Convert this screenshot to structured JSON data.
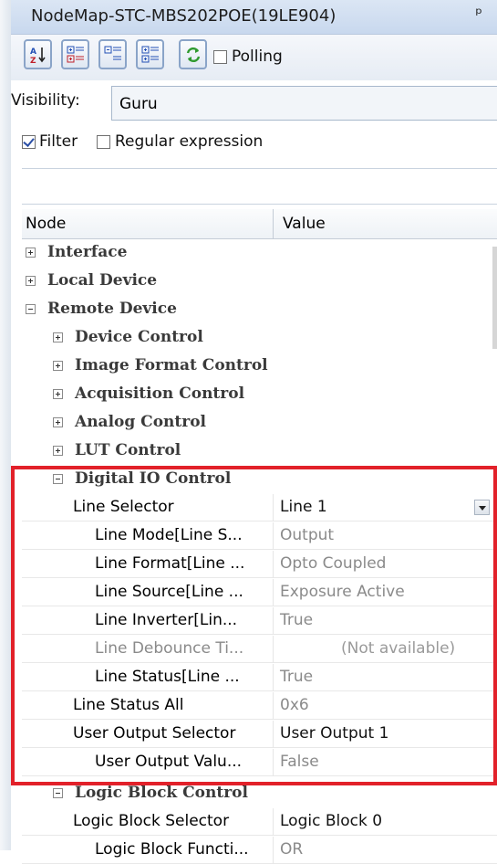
{
  "window": {
    "title": "NodeMap-STC-MBS202POE(19LE904)",
    "pin_icon": "pin-icon"
  },
  "toolbar": {
    "buttons": [
      {
        "name": "sort-az-icon"
      },
      {
        "name": "expand-all-icon"
      },
      {
        "name": "collapse-all-icon"
      },
      {
        "name": "expand-selected-icon"
      },
      {
        "name": "refresh-icon"
      }
    ],
    "polling_label": "Polling",
    "polling_checked": false
  },
  "visibility": {
    "label": "Visibility:",
    "value": "Guru"
  },
  "filter": {
    "filter_label": "Filter",
    "filter_checked": true,
    "regex_label": "Regular expression",
    "regex_checked": false,
    "input_value": ""
  },
  "grid": {
    "header_node": "Node",
    "header_value": "Value",
    "rows": [
      {
        "type": "category",
        "label": "Interface",
        "expanded": false
      },
      {
        "type": "category",
        "label": "Local Device",
        "expanded": false
      },
      {
        "type": "category",
        "label": "Remote Device",
        "expanded": true
      },
      {
        "type": "category",
        "label": "Device Control",
        "expanded": false
      },
      {
        "type": "category",
        "label": "Image Format Control",
        "expanded": false
      },
      {
        "type": "category",
        "label": "Acquisition Control",
        "expanded": false
      },
      {
        "type": "category",
        "label": "Analog Control",
        "expanded": false
      },
      {
        "type": "category",
        "label": "LUT Control",
        "expanded": false
      },
      {
        "type": "category",
        "label": "Digital IO Control",
        "expanded": true
      },
      {
        "type": "property",
        "label": "Line Selector",
        "value": "Line 1"
      },
      {
        "type": "property",
        "label": "Line Mode[Line S...",
        "value": "Output"
      },
      {
        "type": "property",
        "label": "Line Format[Line ...",
        "value": "Opto Coupled"
      },
      {
        "type": "property",
        "label": "Line Source[Line ...",
        "value": "Exposure Active"
      },
      {
        "type": "property",
        "label": "Line Inverter[Lin...",
        "value": "True"
      },
      {
        "type": "property",
        "label": "Line Debounce Ti...",
        "value": "(Not available)"
      },
      {
        "type": "property",
        "label": "Line Status[Line ...",
        "value": "True"
      },
      {
        "type": "property",
        "label": "Line Status All",
        "value": "0x6"
      },
      {
        "type": "property",
        "label": "User Output Selector",
        "value": "User Output 1"
      },
      {
        "type": "property",
        "label": "User Output Valu...",
        "value": "False"
      },
      {
        "type": "category",
        "label": "Logic Block Control",
        "expanded": true
      },
      {
        "type": "property",
        "label": "Logic Block Selector",
        "value": "Logic Block 0"
      },
      {
        "type": "property",
        "label": "Logic Block Functi...",
        "value": "OR"
      }
    ]
  },
  "highlight_color": "#e2212a"
}
